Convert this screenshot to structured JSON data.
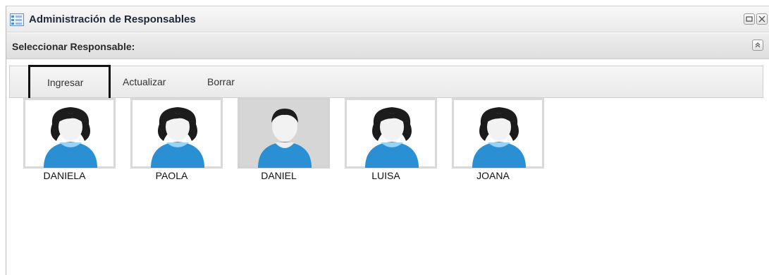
{
  "window": {
    "title": "Administración de Responsables",
    "buttons": [
      "restore-icon",
      "close-icon"
    ]
  },
  "panel": {
    "title": "Seleccionar Responsable:"
  },
  "toolbar": {
    "ingresar": "Ingresar",
    "actualizar": "Actualizar",
    "borrar": "Borrar"
  },
  "people": [
    {
      "name": "DANIELA",
      "gender": "female",
      "selected": false
    },
    {
      "name": "PAOLA",
      "gender": "female",
      "selected": false
    },
    {
      "name": "DANIEL",
      "gender": "male",
      "selected": true
    },
    {
      "name": "LUISA",
      "gender": "female",
      "selected": false
    },
    {
      "name": "JOANA",
      "gender": "female",
      "selected": false
    }
  ],
  "colors": {
    "accent": "#2b8fd4",
    "hair": "#1c1c1c",
    "selected_bg": "#d6d6d6"
  }
}
